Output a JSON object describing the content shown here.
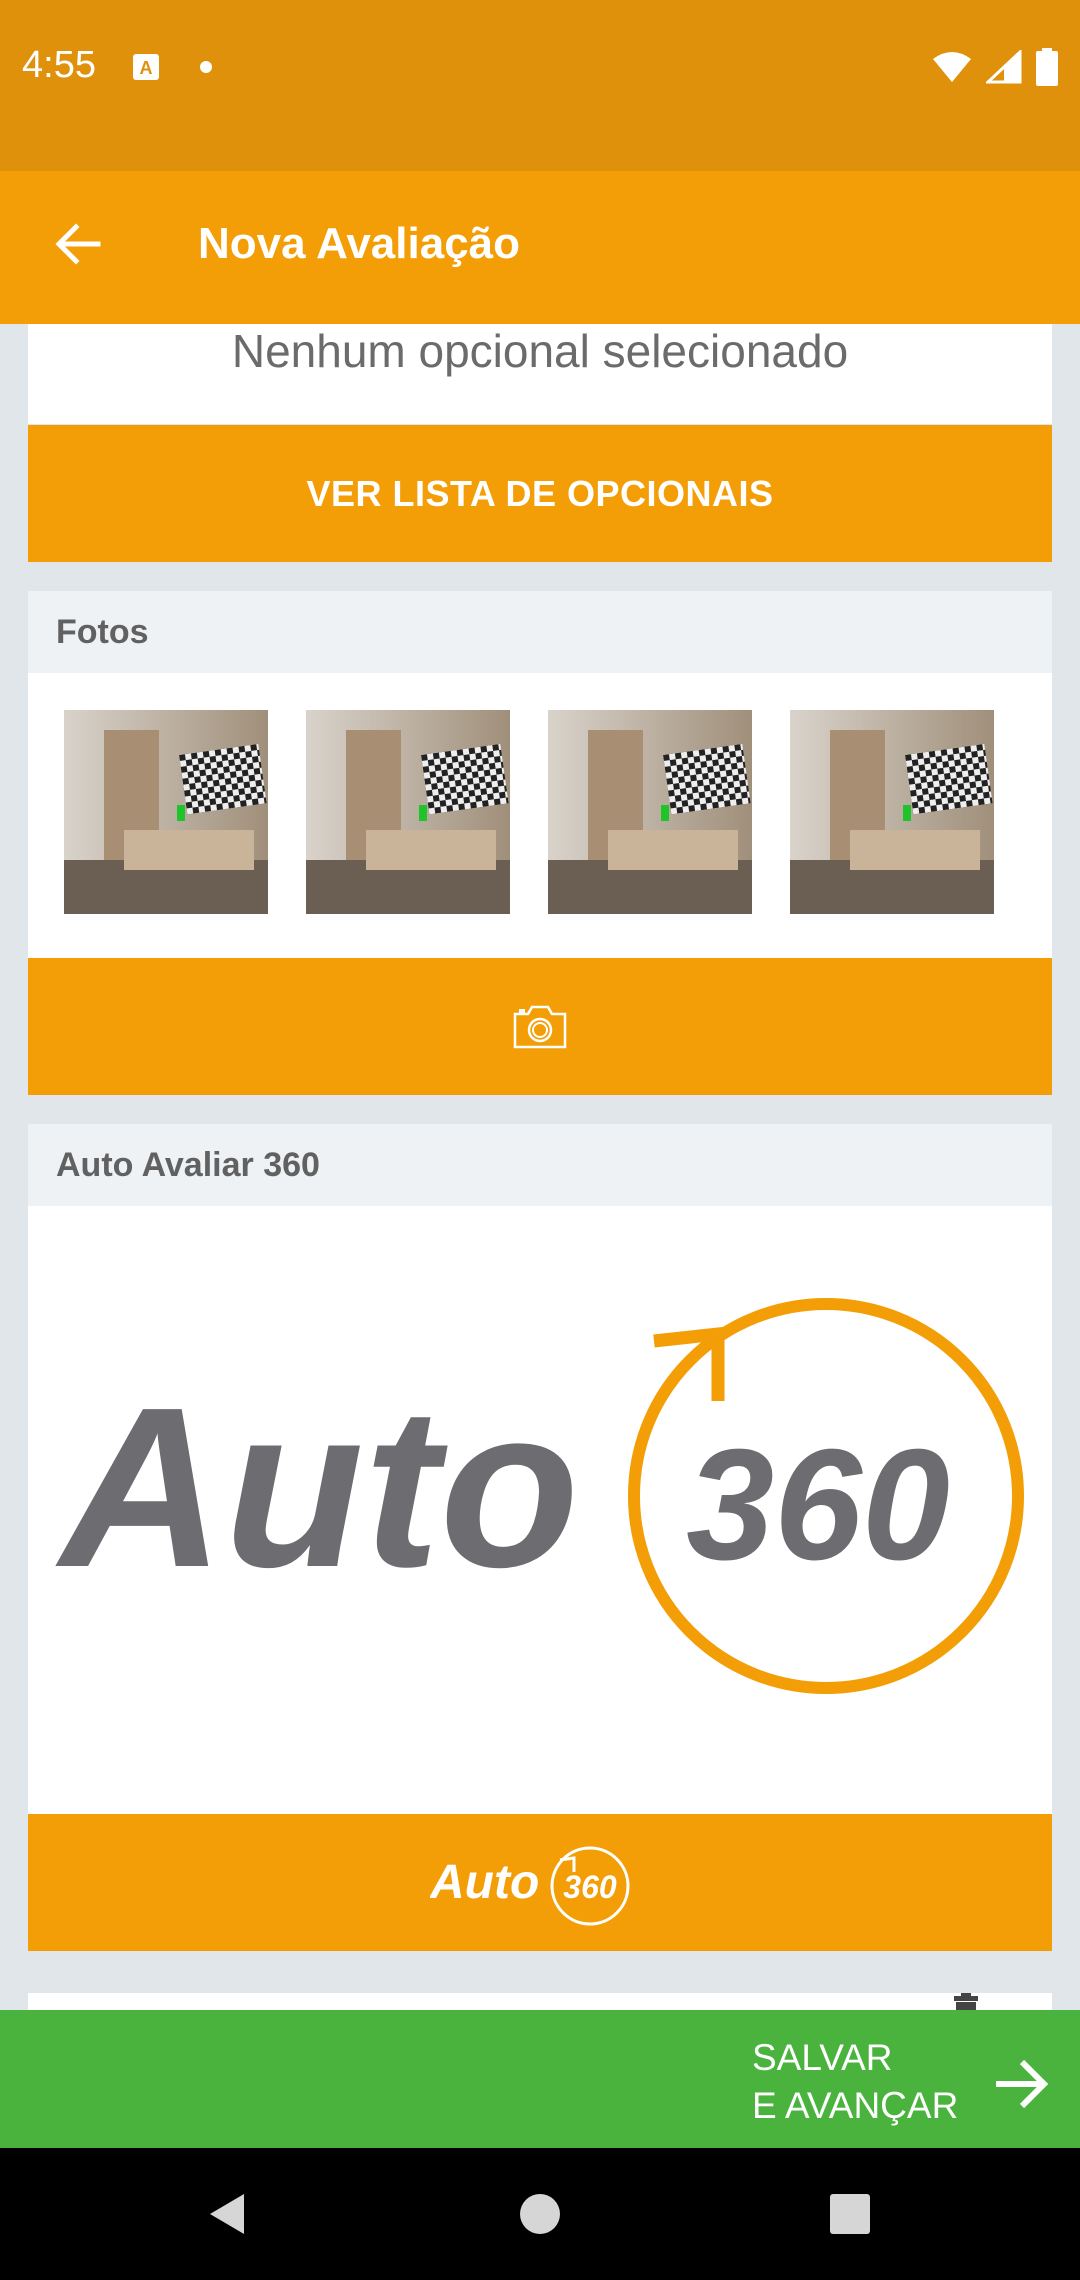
{
  "status_bar": {
    "time": "4:55"
  },
  "app_bar": {
    "title": "Nova Avaliação"
  },
  "opcionais": {
    "empty_text": "Nenhum opcional selecionado",
    "list_button": "VER LISTA DE OPCIONAIS"
  },
  "fotos": {
    "title": "Fotos",
    "photos": [
      "photo-1",
      "photo-2",
      "photo-3",
      "photo-4"
    ],
    "camera_icon": "camera-icon"
  },
  "auto360": {
    "title": "Auto Avaliar 360",
    "logo_word": "Auto",
    "logo_number": "360",
    "button_word": "Auto",
    "button_number": "360"
  },
  "footer": {
    "save_line1": "SALVAR",
    "save_line2": "E AVANÇAR"
  },
  "colors": {
    "status_bar": "#e0910b",
    "accent": "#f39e06",
    "save_green": "#4ab33e",
    "logo_gray": "#6d6d71"
  }
}
